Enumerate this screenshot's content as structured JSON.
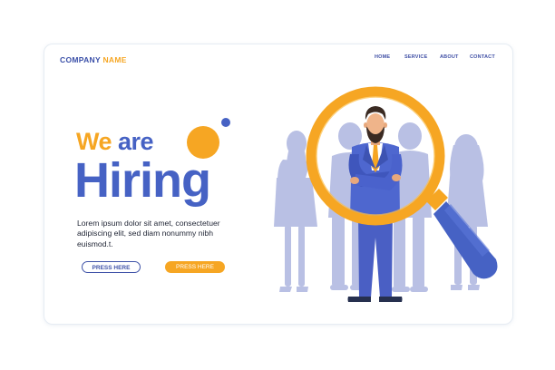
{
  "brand": {
    "part1": "COMPANY",
    "part2": "NAME"
  },
  "nav": {
    "items": [
      "HOME",
      "SERVICE",
      "ABOUT",
      "CONTACT"
    ]
  },
  "hero": {
    "title_word1": "We",
    "title_word2": "are",
    "title_line2": "Hiring",
    "body": "Lorem ipsum dolor sit amet, consectetuer adipiscing elit, sed diam nonummy nibh euismod.t."
  },
  "buttons": {
    "primary_label": "PRESS HERE",
    "secondary_label": "PRESS HERE"
  },
  "colors": {
    "accent": "#f6a623",
    "brand_blue": "#4662c4",
    "silhouette": "#b9c0e4",
    "text_dark": "#1f2434"
  },
  "icons": [
    "magnifying-glass-illustration",
    "businessman-illustration"
  ]
}
